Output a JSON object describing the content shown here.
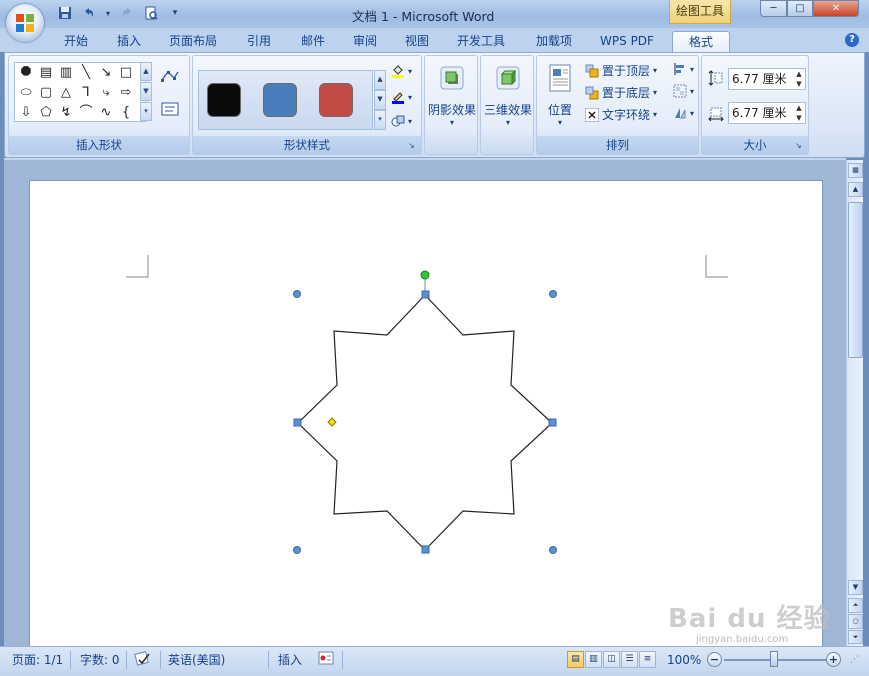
{
  "window": {
    "title": "文档 1 - Microsoft Word",
    "context_tab": "绘图工具",
    "minimize": "─",
    "maximize": "□",
    "close": "✕"
  },
  "quick_access": {
    "save_icon": "floppy-icon",
    "undo_icon": "undo-icon",
    "redo_icon": "redo-icon",
    "print_preview_icon": "print-preview-icon",
    "customize_icon": "dropdown-icon"
  },
  "tabs": [
    {
      "label": "开始"
    },
    {
      "label": "插入"
    },
    {
      "label": "页面布局"
    },
    {
      "label": "引用"
    },
    {
      "label": "邮件"
    },
    {
      "label": "审阅"
    },
    {
      "label": "视图"
    },
    {
      "label": "开发工具"
    },
    {
      "label": "加载项"
    },
    {
      "label": "WPS PDF"
    },
    {
      "label": "格式",
      "active": true
    }
  ],
  "ribbon": {
    "groups": {
      "insert_shapes": "插入形状",
      "shape_styles": "形状样式",
      "shadow_effects": "阴影效果",
      "three_d_effects": "三维效果",
      "arrange": "排列",
      "size": "大小"
    },
    "shape_styles": [
      {
        "color": "#0a0a0a"
      },
      {
        "color": "#4a7dbb"
      },
      {
        "color": "#c24b46"
      }
    ],
    "arrange": {
      "position": "位置",
      "bring_to_front": "置于顶层",
      "send_to_back": "置于底层",
      "text_wrapping": "文字环绕"
    },
    "size": {
      "height": "6.77 厘米",
      "width": "6.77 厘米"
    }
  },
  "statusbar": {
    "page": "页面: 1/1",
    "words": "字数: 0",
    "language": "英语(美国)",
    "mode": "插入",
    "zoom": "100%",
    "zoom_level": 1.0
  },
  "watermark": {
    "brand": "Bai du 经验",
    "url": "jingyan.baidu.com"
  },
  "colors": {
    "handle_blue": "#5b8fd6",
    "rotate_green": "#22cc33",
    "adjust_yellow": "#f5e100"
  }
}
